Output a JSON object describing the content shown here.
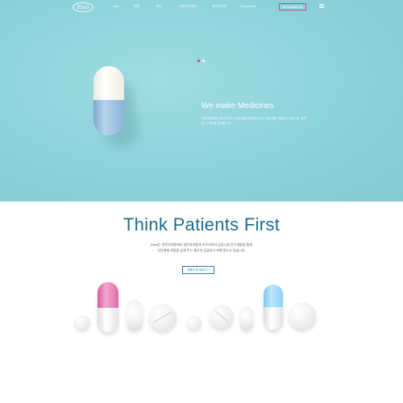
{
  "nav": {
    "logo": "Eisai",
    "items": [
      "Site",
      "제품",
      "회사",
      "기업사회책임",
      "파이프라인",
      "Ecosystem"
    ],
    "contact": "Contact Us",
    "menu_icon": "hamburger-icon"
  },
  "hero": {
    "title": "We make Medicines",
    "description": "에자이제약은 우리 모두의 건강한 삶을 위해 혁신적인 치료제를 개발하고 있습니다. 환자와 그 가족을 생각합니다.",
    "slide_index": 1,
    "slide_count": 2
  },
  "section": {
    "title": "Think Patients First",
    "description_line1": "Eisai는 전문의약품에서 일반의약품에 이르기까지 임상시험 연구개발을 통해",
    "description_line2": "인간에게 희망을 심게 주는 좋은약 공급하기 위해 힘쓰고 있습니다.",
    "button": "제품소개 바로가기"
  },
  "colors": {
    "hero_bg": "#8fd3db",
    "accent_pink": "#c0468a",
    "title_blue": "#1d6d8f",
    "active_dot": "#e0344f"
  }
}
